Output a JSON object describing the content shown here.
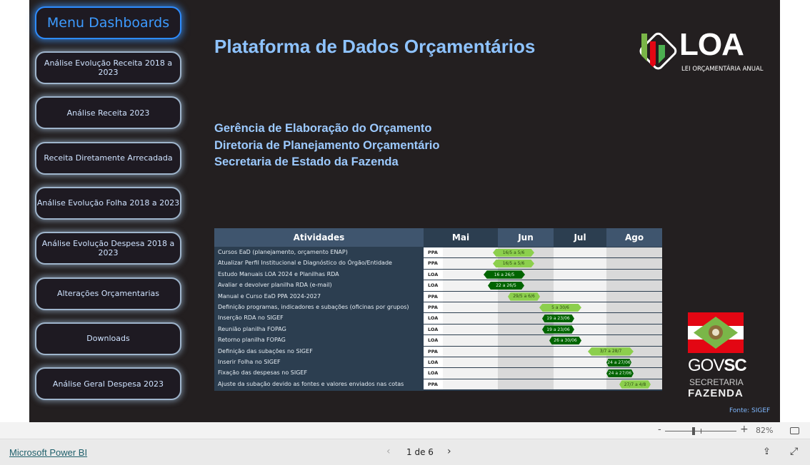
{
  "menu": {
    "title": "Menu Dashboards",
    "items": [
      "Análise Evolução Receita 2018 a 2023",
      "Análise Receita 2023",
      "Receita Diretamente Arrecadada",
      "Análise Evolução Folha 2018 a 2023",
      "Análise Evolução Despesa 2018 a 2023",
      "Alterações Orçamentarias",
      "Downloads",
      "Análise Geral Despesa 2023"
    ]
  },
  "header": {
    "title": "Plataforma de Dados Orçamentários",
    "subtitles": [
      "Gerência de Elaboração do Orçamento",
      "Diretoria de Planejamento Orçamentário",
      "Secretaria de Estado da Fazenda"
    ]
  },
  "logo_loa": {
    "text": "LOA",
    "tagline": "LEI ORÇAMENTÁRIA ANUAL"
  },
  "logo_gov": {
    "text1": "GOV",
    "text2": "SC",
    "line1": "SECRETARIA",
    "line2": "FAZENDA",
    "colors": {
      "red": "#e30613",
      "green": "#7ab648"
    }
  },
  "schedule": {
    "header": "Atividades",
    "months": [
      "Mai",
      "Jun",
      "Jul",
      "Ago"
    ],
    "rows": [
      {
        "activity": "Cursos EaD (planejamento, orçamento ENAP)",
        "type": "PPA",
        "period": "16/5 a 5/6"
      },
      {
        "activity": "Atualizar Perfil Institucional e Diagnóstico do Órgão/Entidade",
        "type": "PPA",
        "period": "16/5 a 5/6"
      },
      {
        "activity": "Estudo Manuais LOA 2024 e Planilhas RDA",
        "type": "LOA",
        "period": "16 a 26/5"
      },
      {
        "activity": "Avaliar e devolver planilha RDA (e-mail)",
        "type": "LOA",
        "period": "22 a 26/5"
      },
      {
        "activity": "Manual e Curso EaD  PPA 2024-2027",
        "type": "PPA",
        "period": "29/5 a 6/6"
      },
      {
        "activity": "Definição programas, indicadores e subações (oficinas por grupos)",
        "type": "PPA",
        "period": "5 a 30/6"
      },
      {
        "activity": "Inserção RDA no SIGEF",
        "type": "LOA",
        "period": "19 a 23/06"
      },
      {
        "activity": "Reunião planilha FOPAG",
        "type": "LOA",
        "period": "19 a 23/06"
      },
      {
        "activity": "Retorno planilha FOPAG",
        "type": "LOA",
        "period": "26 a 30/06"
      },
      {
        "activity": "Definição das subações no SIGEF",
        "type": "PPA",
        "period": "3/7 a 28/7"
      },
      {
        "activity": "Inserir Folha no SIGEF",
        "type": "LOA",
        "period": "24 a 27/06"
      },
      {
        "activity": "Fixação das despesas no SIGEF",
        "type": "LOA",
        "period": "24 a 27/06"
      },
      {
        "activity": "Ajuste da subação devido as fontes e valores enviados nas cotas",
        "type": "PPA",
        "period": "27/7 a 4/8"
      }
    ],
    "colors": {
      "PPA": "#8ccf4d",
      "LOA": "#006400",
      "header": "#2c3e50"
    }
  },
  "source": "Fonte: SIGEF",
  "zoom": {
    "minus": "-",
    "plus": "+",
    "level": "82%",
    "value_percent": 82
  },
  "footer": {
    "brand_link": "Microsoft Power BI",
    "page": "1 de 6"
  }
}
